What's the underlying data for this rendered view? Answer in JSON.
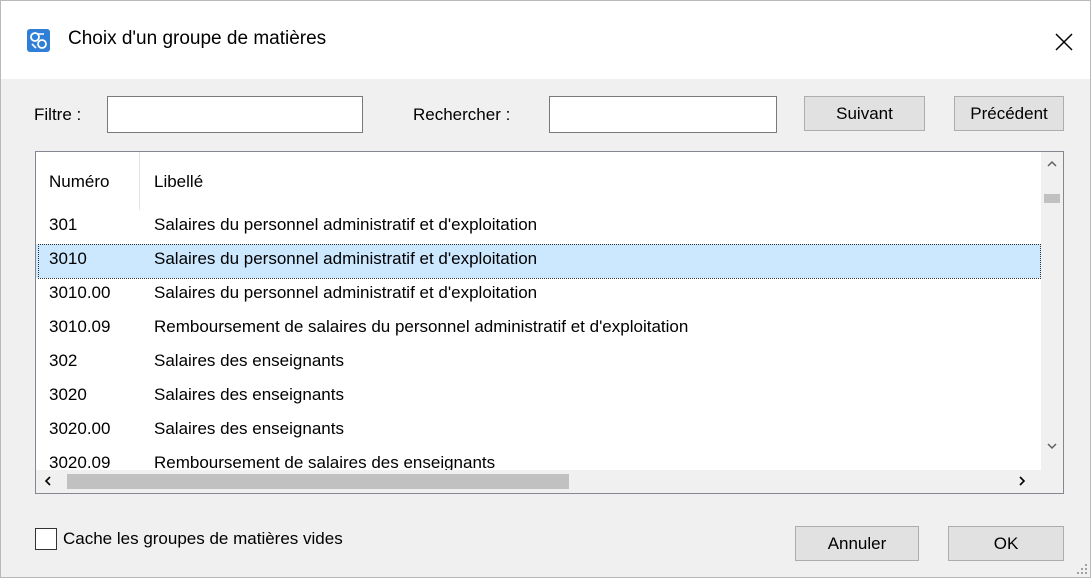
{
  "window": {
    "title": "Choix d'un groupe de matières",
    "icon": "app-icon"
  },
  "filter": {
    "label": "Filtre :",
    "value": "",
    "placeholder": ""
  },
  "search": {
    "label": "Rechercher :",
    "value": "",
    "placeholder": "",
    "next_label": "Suivant",
    "prev_label": "Précédent"
  },
  "list": {
    "columns": [
      "Numéro",
      "Libellé"
    ],
    "rows": [
      {
        "numero": "301",
        "libelle": "Salaires du personnel administratif et d'exploitation"
      },
      {
        "numero": "3010",
        "libelle": "Salaires du personnel administratif et d'exploitation"
      },
      {
        "numero": "3010.00",
        "libelle": "Salaires du personnel administratif et d'exploitation"
      },
      {
        "numero": "3010.09",
        "libelle": "Remboursement de salaires du personnel administratif et d'exploitation"
      },
      {
        "numero": "302",
        "libelle": "Salaires des enseignants"
      },
      {
        "numero": "3020",
        "libelle": "Salaires des enseignants"
      },
      {
        "numero": "3020.00",
        "libelle": "Salaires des enseignants"
      },
      {
        "numero": "3020.09",
        "libelle": "Remboursement de salaires des enseignants"
      }
    ],
    "selected_index": 1,
    "selection_color": "#cce8ff"
  },
  "footer": {
    "hide_empty_label": "Cache les groupes de matières vides",
    "hide_empty_checked": false,
    "cancel_label": "Annuler",
    "ok_label": "OK"
  }
}
